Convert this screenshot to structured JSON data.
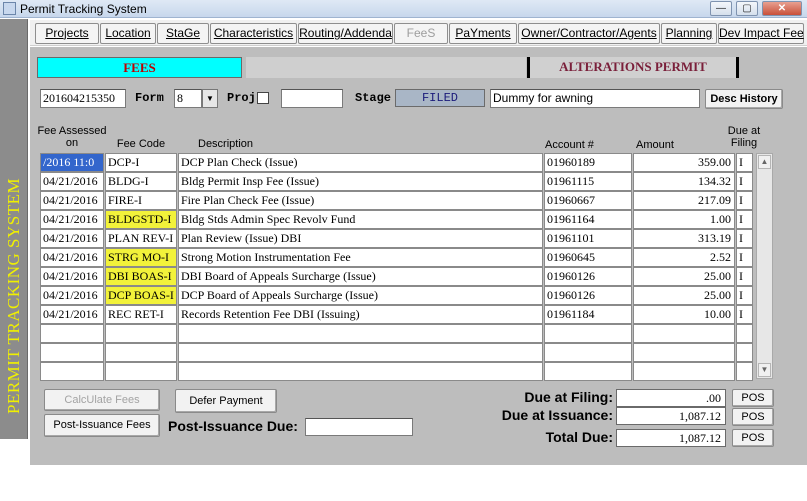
{
  "window": {
    "title": "Permit Tracking System",
    "min": "—",
    "max": "▢",
    "close": "✕"
  },
  "sidebar": {
    "label": "PERMIT TRACKING SYSTEM"
  },
  "nav": [
    "Projects",
    "Location",
    "StaGe",
    "Characteristics",
    "Routing/Addenda",
    "FeeS",
    "PaYments",
    "Owner/Contractor/Agents",
    "Planning",
    "Dev Impact Fee"
  ],
  "header": {
    "section": "FEES",
    "permit_type": "ALTERATIONS PERMIT"
  },
  "form": {
    "permit_number": "201604215350",
    "form_label": "Form",
    "form_value": "8",
    "proj_label": "Proj",
    "proj_value": "",
    "stage_label": "Stage",
    "stage_value": "FILED",
    "description": "Dummy for awning",
    "desc_history": "Desc History"
  },
  "columns": {
    "fee_assessed": "Fee Assessed on",
    "fee_code": "Fee Code",
    "description": "Description",
    "account": "Account #",
    "amount": "Amount",
    "due_at_filing": "Due at Filing"
  },
  "fees": [
    {
      "date": "/2016 11:0",
      "code": "DCP-I",
      "desc": "DCP Plan Check (Issue)",
      "account": "01960189",
      "amount": "359.00",
      "due": "I",
      "hl": false
    },
    {
      "date": "04/21/2016",
      "code": "BLDG-I",
      "desc": "Bldg Permit Insp Fee (Issue)",
      "account": "01961115",
      "amount": "134.32",
      "due": "I",
      "hl": false
    },
    {
      "date": "04/21/2016",
      "code": "FIRE-I",
      "desc": "Fire Plan Check Fee (Issue)",
      "account": "01960667",
      "amount": "217.09",
      "due": "I",
      "hl": false
    },
    {
      "date": "04/21/2016",
      "code": "BLDGSTD-I",
      "desc": "Bldg Stds Admin Spec Revolv Fund",
      "account": "01961164",
      "amount": "1.00",
      "due": "I",
      "hl": true
    },
    {
      "date": "04/21/2016",
      "code": "PLAN REV-I",
      "desc": "Plan Review (Issue)  DBI",
      "account": "01961101",
      "amount": "313.19",
      "due": "I",
      "hl": false
    },
    {
      "date": "04/21/2016",
      "code": "STRG MO-I",
      "desc": "Strong Motion Instrumentation Fee",
      "account": "01960645",
      "amount": "2.52",
      "due": "I",
      "hl": true
    },
    {
      "date": "04/21/2016",
      "code": "DBI BOAS-I",
      "desc": "DBI Board of Appeals Surcharge (Issue)",
      "account": "01960126",
      "amount": "25.00",
      "due": "I",
      "hl": true
    },
    {
      "date": "04/21/2016",
      "code": "DCP BOAS-I",
      "desc": "DCP Board of Appeals Surcharge (Issue)",
      "account": "01960126",
      "amount": "25.00",
      "due": "I",
      "hl": true
    },
    {
      "date": "04/21/2016",
      "code": "REC RET-I",
      "desc": "Records Retention Fee DBI (Issuing)",
      "account": "01961184",
      "amount": "10.00",
      "due": "I",
      "hl": false
    },
    {
      "date": "",
      "code": "",
      "desc": "",
      "account": "",
      "amount": "",
      "due": "",
      "hl": false
    },
    {
      "date": "",
      "code": "",
      "desc": "",
      "account": "",
      "amount": "",
      "due": "",
      "hl": false
    },
    {
      "date": "",
      "code": "",
      "desc": "",
      "account": "",
      "amount": "",
      "due": "",
      "hl": false
    }
  ],
  "actions": {
    "calculate": "CalcUlate Fees",
    "defer": "Defer Payment",
    "post_issuance": "Post-Issuance Fees",
    "post_issuance_due_label": "Post-Issuance Due:",
    "post_issuance_due_value": ""
  },
  "summary": {
    "due_filing_label": "Due at Filing:",
    "due_filing": ".00",
    "due_issuance_label": "Due at  Issuance:",
    "due_issuance": "1,087.12",
    "total_label": "Total  Due:",
    "total": "1,087.12",
    "pos": "POS"
  }
}
